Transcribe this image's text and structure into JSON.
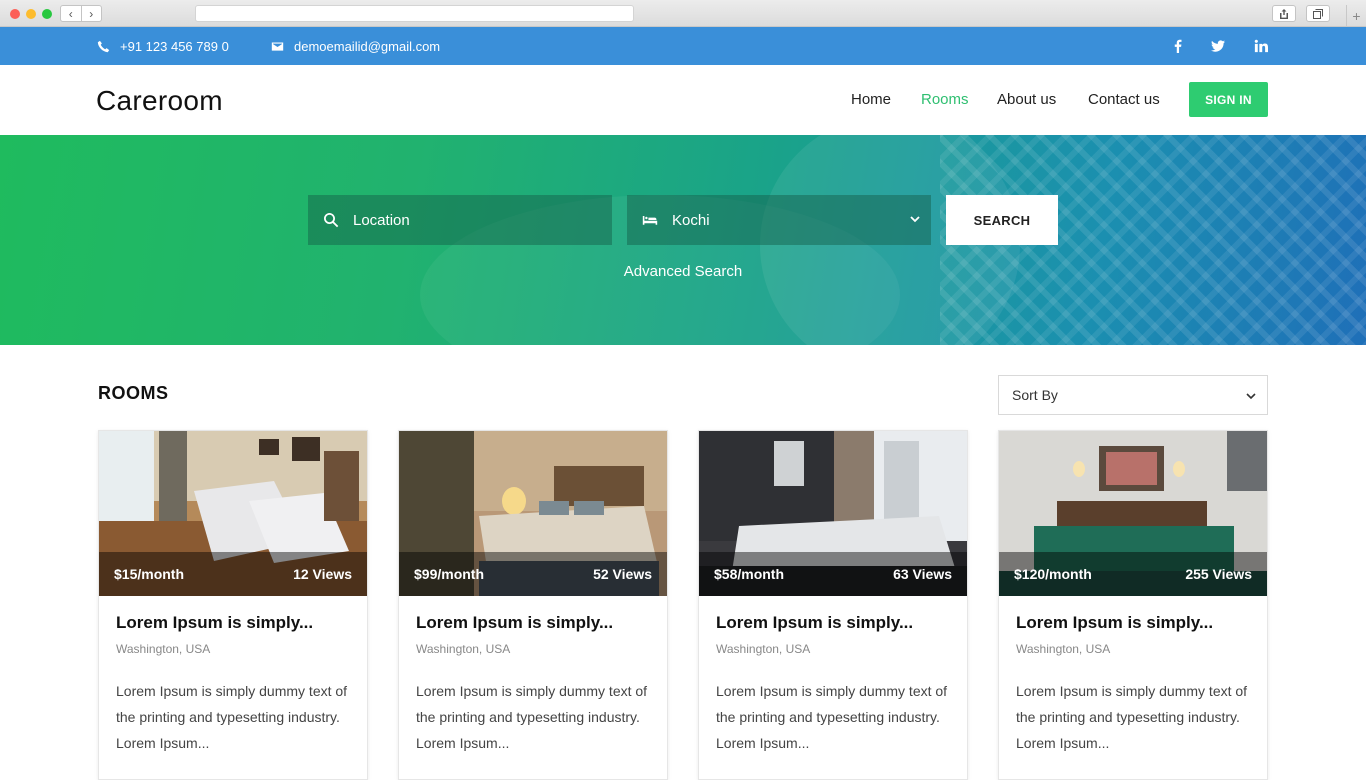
{
  "topbar": {
    "phone": "+91 123 456 789 0",
    "email": "demoemailid@gmail.com"
  },
  "header": {
    "logo": "Careroom",
    "nav": [
      "Home",
      "Rooms",
      "About us",
      "Contact us"
    ],
    "active_nav": "Rooms",
    "signin_label": "SIGN IN"
  },
  "search": {
    "location_placeholder": "Location",
    "city_value": "Kochi",
    "button_label": "SEARCH",
    "advanced_label": "Advanced Search"
  },
  "rooms": {
    "title": "ROOMS",
    "sort_label": "Sort By",
    "cards": [
      {
        "price": "$15/month",
        "views": "12 Views",
        "title": "Lorem Ipsum is simply...",
        "location": "Washington, USA",
        "description": "Lorem Ipsum is simply dummy text of the printing and typesetting industry. Lorem Ipsum..."
      },
      {
        "price": "$99/month",
        "views": "52 Views",
        "title": "Lorem Ipsum is simply...",
        "location": "Washington, USA",
        "description": "Lorem Ipsum is simply dummy text of the printing and typesetting industry. Lorem Ipsum..."
      },
      {
        "price": "$58/month",
        "views": "63 Views",
        "title": "Lorem Ipsum is simply...",
        "location": "Washington, USA",
        "description": "Lorem Ipsum is simply dummy text of the printing and typesetting industry. Lorem Ipsum..."
      },
      {
        "price": "$120/month",
        "views": "255 Views",
        "title": "Lorem Ipsum is simply...",
        "location": "Washington, USA",
        "description": "Lorem Ipsum is simply dummy text of the printing and typesetting industry. Lorem Ipsum..."
      }
    ]
  },
  "colors": {
    "topbar": "#3a8fd9",
    "accent_green": "#2ecc71",
    "active_nav": "#2fbf71"
  },
  "icons": [
    "phone-icon",
    "mail-icon",
    "facebook-icon",
    "twitter-icon",
    "linkedin-icon",
    "search-icon",
    "bed-icon",
    "chevron-down-icon"
  ]
}
